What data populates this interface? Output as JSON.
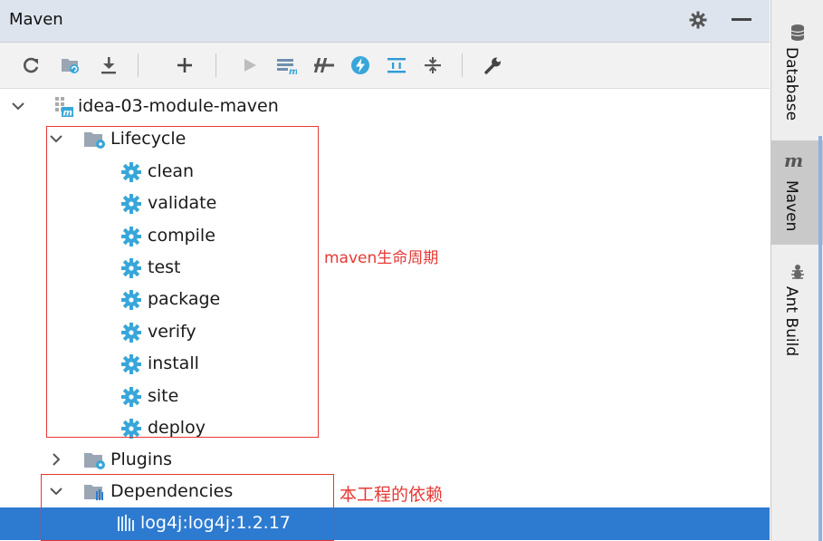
{
  "panel": {
    "title": "Maven"
  },
  "toolbar": {
    "buttons": [
      {
        "name": "reimport-icon",
        "glyph": "↻"
      },
      {
        "name": "generate-sources-icon",
        "glyph": ""
      },
      {
        "name": "download-sources-icon",
        "glyph": ""
      },
      {
        "name": "add-project-icon",
        "glyph": "+"
      },
      {
        "name": "run-icon",
        "glyph": "▶"
      },
      {
        "name": "execute-goal-icon",
        "glyph": ""
      },
      {
        "name": "toggle-offline-icon",
        "glyph": ""
      },
      {
        "name": "skip-tests-icon",
        "glyph": "⚡"
      },
      {
        "name": "show-dependencies-icon",
        "glyph": ""
      },
      {
        "name": "collapse-all-icon",
        "glyph": ""
      },
      {
        "name": "settings-wrench-icon",
        "glyph": ""
      }
    ]
  },
  "tree": {
    "root": "idea-03-module-maven",
    "lifecycle": {
      "label": "Lifecycle",
      "goals": [
        "clean",
        "validate",
        "compile",
        "test",
        "package",
        "verify",
        "install",
        "site",
        "deploy"
      ]
    },
    "plugins": {
      "label": "Plugins"
    },
    "dependencies": {
      "label": "Dependencies",
      "items": [
        "log4j:log4j:1.2.17"
      ]
    }
  },
  "annotations": {
    "lifecycle_note": "maven生命周期",
    "dependencies_note": "本工程的依赖"
  },
  "side_tabs": [
    {
      "label": "Database",
      "icon": "database-icon"
    },
    {
      "label": "Maven",
      "icon": "maven-icon"
    },
    {
      "label": "Ant Build",
      "icon": "ant-icon"
    }
  ],
  "colors": {
    "selection": "#2d7bd1",
    "annotation": "#e53935",
    "goal_icon": "#38a6d8",
    "folder": "#9aa6b3"
  }
}
